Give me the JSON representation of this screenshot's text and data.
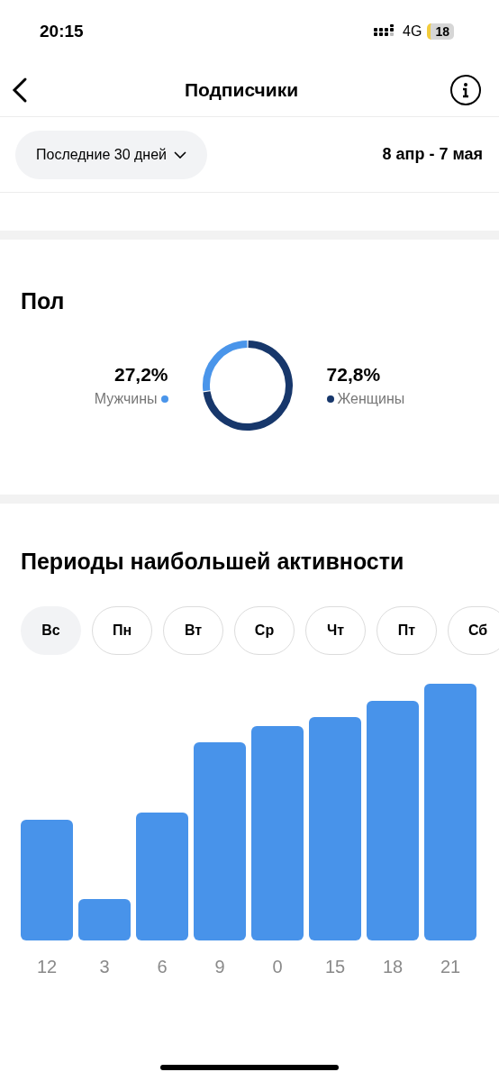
{
  "status_bar": {
    "time": "20:15",
    "network": "4G",
    "battery": "18"
  },
  "header": {
    "title": "Подписчики"
  },
  "filter": {
    "period": "Последние 30 дней",
    "range": "8 апр - 7 мая"
  },
  "gender": {
    "title": "Пол",
    "items": [
      {
        "value": "27,2%",
        "label": "Мужчины",
        "color": "#4a95ea"
      },
      {
        "value": "72,8%",
        "label": "Женщины",
        "color": "#17376b"
      }
    ]
  },
  "activity": {
    "title": "Периоды наибольшей активности",
    "days": [
      {
        "label": "Вс",
        "selected": true
      },
      {
        "label": "Пн",
        "selected": false
      },
      {
        "label": "Вт",
        "selected": false
      },
      {
        "label": "Ср",
        "selected": false
      },
      {
        "label": "Чт",
        "selected": false
      },
      {
        "label": "Пт",
        "selected": false
      },
      {
        "label": "Сб",
        "selected": false
      }
    ],
    "hours": [
      "12",
      "3",
      "6",
      "9",
      "0",
      "15",
      "18",
      "21"
    ]
  }
}
